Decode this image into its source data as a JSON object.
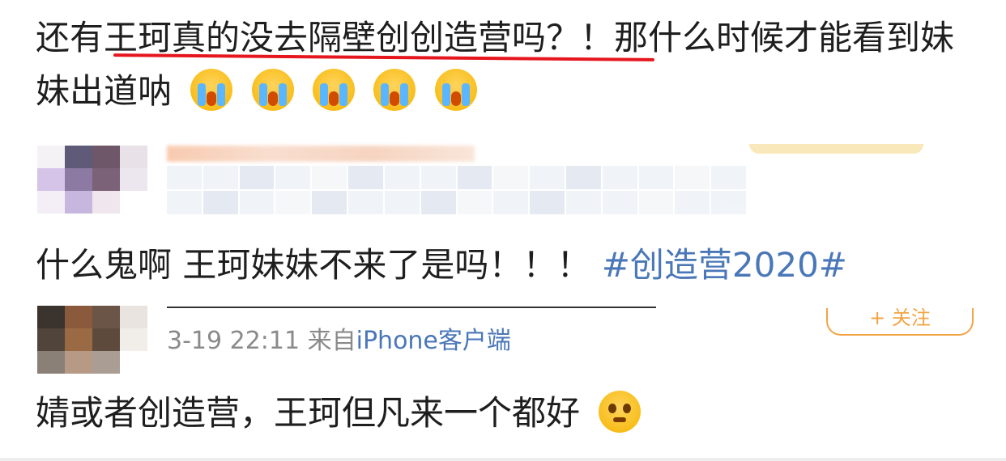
{
  "comments": {
    "first": {
      "text": "还有王珂真的没去隔壁创创造营吗？！那什么时候才能看到妹妹出道呐",
      "emojis": [
        "crying-face-emoji",
        "crying-face-emoji",
        "crying-face-emoji",
        "crying-face-emoji",
        "crying-face-emoji"
      ]
    },
    "second": {
      "text": "什么鬼啊 王珂妹妹不来了是吗！！！",
      "hashtag": "#创造营2020#"
    },
    "third": {
      "text": "婧或者创造营，王珂但凡来一个都好",
      "emoji": "pleading-face-emoji"
    }
  },
  "post_meta": {
    "time": "3-19 22:11",
    "from": "来自",
    "client": "iPhone客户端"
  },
  "follow_button": {
    "label": "+ 关注"
  },
  "colors": {
    "hashtag": "#4a77b8",
    "underline": "#e6161f",
    "follow": "#f2a445"
  }
}
